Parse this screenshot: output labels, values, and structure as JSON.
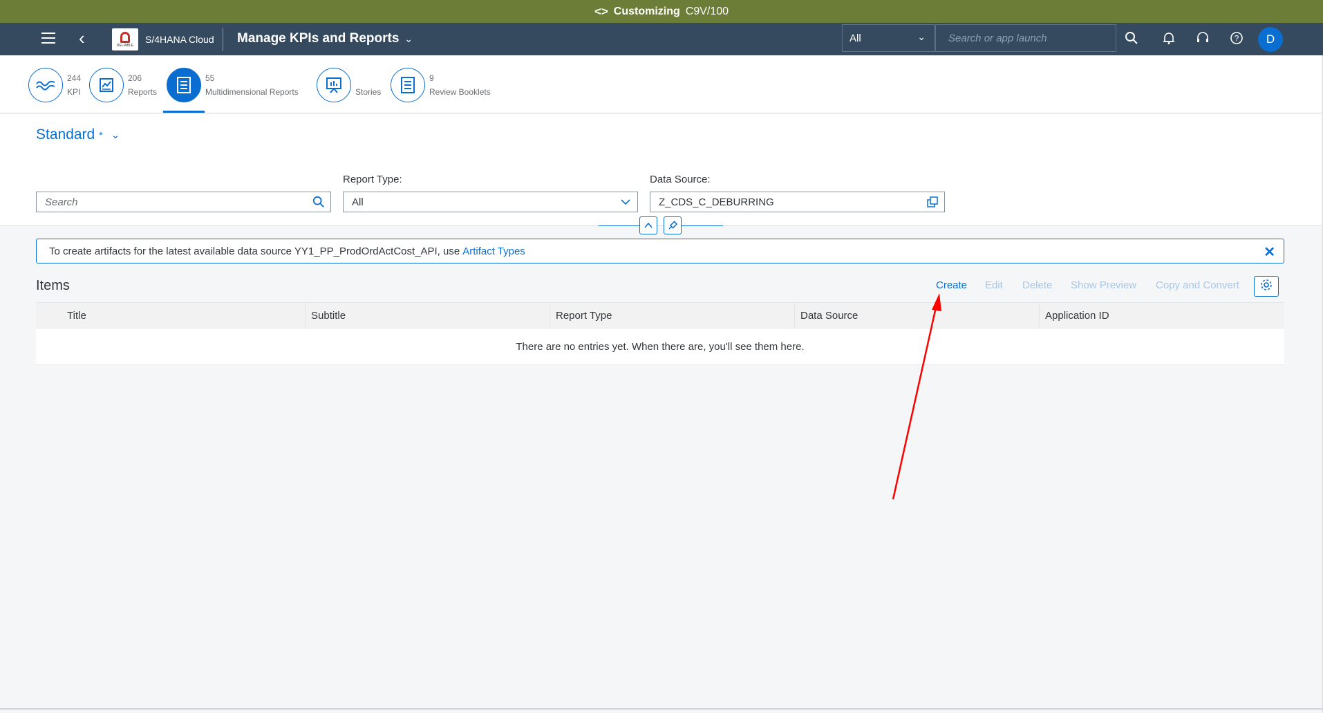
{
  "system_banner": {
    "title": "Customizing",
    "client": "C9V/100"
  },
  "shell": {
    "logo_text": "RELIABLE",
    "brand": "S/4HANA Cloud",
    "app_title": "Manage KPIs and Reports",
    "search_scope": "All",
    "search_placeholder": "Search or app launch",
    "avatar_initial": "D"
  },
  "tabs": [
    {
      "count": "244",
      "label": "KPI",
      "icon": "kpi-icon"
    },
    {
      "count": "206",
      "label": "Reports",
      "icon": "report-icon"
    },
    {
      "count": "55",
      "label": "Multidimensional Reports",
      "icon": "multidimensional-report-icon",
      "active": true
    },
    {
      "count": "",
      "label": "Stories",
      "icon": "story-icon"
    },
    {
      "count": "9",
      "label": "Review Booklets",
      "icon": "booklet-icon"
    }
  ],
  "filters": {
    "variant": "Standard",
    "variant_modified": "*",
    "search_placeholder": "Search",
    "report_type_label": "Report Type:",
    "report_type_value": "All",
    "data_source_label": "Data Source:",
    "data_source_value": "Z_CDS_C_DEBURRING"
  },
  "message": {
    "text": "To create artifacts for the latest available data source YY1_PP_ProdOrdActCost_API, use",
    "link": "Artifact Types"
  },
  "items": {
    "title": "Items",
    "actions": {
      "create": "Create",
      "edit": "Edit",
      "delete": "Delete",
      "preview": "Show Preview",
      "copy": "Copy and Convert"
    },
    "columns": [
      "Title",
      "Subtitle",
      "Report Type",
      "Data Source",
      "Application ID"
    ],
    "empty_text": "There are no entries yet. When there are, you'll see them here."
  },
  "colors": {
    "banner": "#6b7d36",
    "shell": "#354a5f",
    "accent": "#0a6ed1",
    "annotation": "#ff0000"
  }
}
